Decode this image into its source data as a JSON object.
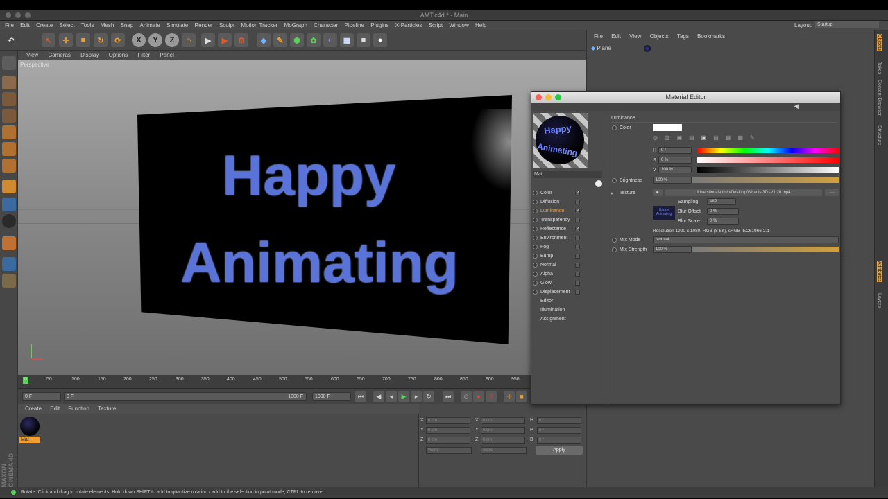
{
  "window": {
    "title": "AMT.c4d * - Main"
  },
  "menu": [
    "File",
    "Edit",
    "Create",
    "Select",
    "Tools",
    "Mesh",
    "Snap",
    "Animate",
    "Simulate",
    "Render",
    "Sculpt",
    "Motion Tracker",
    "MoGraph",
    "Character",
    "Pipeline",
    "Plugins",
    "X-Particles",
    "Script",
    "Window",
    "Help"
  ],
  "layout": {
    "label": "Layout:",
    "value": "Startup"
  },
  "viewport": {
    "menu": [
      "View",
      "Cameras",
      "Display",
      "Options",
      "Filter",
      "Panel"
    ],
    "label": "Perspective",
    "text_line1": "Happy",
    "text_line2": "Animating"
  },
  "timeline": {
    "ticks": [
      "0",
      "50",
      "100",
      "150",
      "200",
      "250",
      "300",
      "350",
      "400",
      "450",
      "500",
      "550",
      "600",
      "650",
      "700",
      "750",
      "800",
      "850",
      "900",
      "950"
    ],
    "current": "0 F",
    "start": "0 F",
    "end": "1000 F",
    "max": "1000 F"
  },
  "material_manager": {
    "menu": [
      "Create",
      "Edit",
      "Function",
      "Texture"
    ],
    "material_name": "Mat"
  },
  "coordinates": {
    "rows": [
      {
        "axis": "X",
        "pos": "0 cm",
        "size_axis": "X",
        "size": "0 cm",
        "rot_axis": "H",
        "rot": "0 °"
      },
      {
        "axis": "Y",
        "pos": "0 cm",
        "size_axis": "Y",
        "size": "0 cm",
        "rot_axis": "P",
        "rot": "0 °"
      },
      {
        "axis": "Z",
        "pos": "0 cm",
        "size_axis": "Z",
        "size": "0 cm",
        "rot_axis": "B",
        "rot": "0 °"
      }
    ],
    "space": "World",
    "mode": "Scale",
    "apply": "Apply"
  },
  "object_manager": {
    "menu": [
      "File",
      "Edit",
      "View",
      "Objects",
      "Tags",
      "Bookmarks"
    ],
    "object": "Plane"
  },
  "right_tabs": [
    "Objects",
    "Takes",
    "Content Browser",
    "Structure",
    "Attributes",
    "Layers"
  ],
  "material_editor": {
    "title": "Material Editor",
    "mat_name": "Mat",
    "preview_line1": "Happy",
    "preview_line2": "Animating",
    "channels": [
      {
        "name": "Color",
        "checked": true
      },
      {
        "name": "Diffusion",
        "checked": false
      },
      {
        "name": "Luminance",
        "checked": true,
        "active": true
      },
      {
        "name": "Transparency",
        "checked": false
      },
      {
        "name": "Reflectance",
        "checked": true
      },
      {
        "name": "Environment",
        "checked": false
      },
      {
        "name": "Fog",
        "checked": false
      },
      {
        "name": "Bump",
        "checked": false
      },
      {
        "name": "Normal",
        "checked": false
      },
      {
        "name": "Alpha",
        "checked": false
      },
      {
        "name": "Glow",
        "checked": false
      },
      {
        "name": "Displacement",
        "checked": false
      }
    ],
    "extra": [
      "Editor",
      "Illumination",
      "Assignment"
    ],
    "section": "Luminance",
    "color_label": "Color",
    "h_label": "H",
    "h_value": "0 °",
    "s_label": "S",
    "s_value": "0 %",
    "v_label": "V",
    "v_value": "100 %",
    "brightness_label": "Brightness",
    "brightness_value": "100 %",
    "texture_label": "Texture",
    "texture_path": "/Users/localadmin/Desktop/What is 3D -V1.20.mp4",
    "sampling_label": "Sampling",
    "sampling_value": "MIP",
    "blur_offset_label": "Blur Offset",
    "blur_offset_value": "0 %",
    "blur_scale_label": "Blur Scale",
    "blur_scale_value": "0 %",
    "resolution": "Resolution 1920 x 1080, RGB (8 Bit), sRGB IEC61966-2.1",
    "mix_mode_label": "Mix Mode",
    "mix_mode_value": "Normal",
    "mix_strength_label": "Mix Strength",
    "mix_strength_value": "100 %",
    "thumb_line1": "Happy",
    "thumb_line2": "Animating"
  },
  "status": "Rotate: Click and drag to rotate elements. Hold down SHIFT to add to quantize rotation / add to the selection in point mode, CTRL to remove.",
  "branding": "MAXON CINEMA 4D",
  "colors": {
    "accent": "#f0a030",
    "text_blue": "#5a73d8",
    "panel": "#4a4a4a"
  }
}
